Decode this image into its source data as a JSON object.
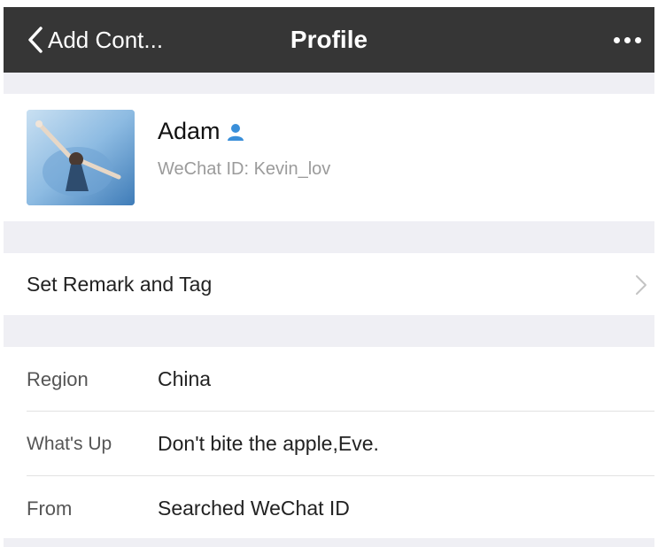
{
  "navbar": {
    "back_label": "Add Cont...",
    "title": "Profile"
  },
  "profile": {
    "name": "Adam",
    "wechat_id_label": "WeChat ID: ",
    "wechat_id_value": "Kevin_lov"
  },
  "remark_row": {
    "label": "Set Remark and Tag"
  },
  "info": [
    {
      "label": "Region",
      "value": "China"
    },
    {
      "label": "What's Up",
      "value": "Don't bite the apple,Eve."
    },
    {
      "label": "From",
      "value": "Searched WeChat ID"
    }
  ],
  "colors": {
    "navbar_bg": "#363636",
    "section_gap": "#efeff4",
    "contact_icon": "#3a8fd9"
  }
}
